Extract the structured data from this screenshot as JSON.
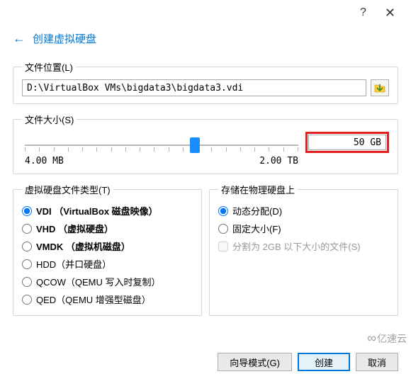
{
  "titlebar": {
    "help_icon": "?",
    "close_icon": "✕"
  },
  "header": {
    "back_arrow": "←",
    "title": "创建虚拟硬盘"
  },
  "file_location": {
    "legend": "文件位置(L)",
    "path": "D:\\VirtualBox VMs\\bigdata3\\bigdata3.vdi"
  },
  "file_size": {
    "legend": "文件大小(S)",
    "value": "50 GB",
    "min_label": "4.00 MB",
    "max_label": "2.00 TB"
  },
  "disk_type": {
    "legend": "虚拟硬盘文件类型(T)",
    "options": [
      {
        "label": "VDI （VirtualBox 磁盘映像）",
        "selected": true,
        "bold": true
      },
      {
        "label": "VHD （虚拟硬盘）",
        "selected": false,
        "bold": true
      },
      {
        "label": "VMDK （虚拟机磁盘）",
        "selected": false,
        "bold": true
      },
      {
        "label": "HDD（并口硬盘）",
        "selected": false,
        "bold": false
      },
      {
        "label": "QCOW（QEMU 写入时复制）",
        "selected": false,
        "bold": false
      },
      {
        "label": "QED（QEMU 增强型磁盘）",
        "selected": false,
        "bold": false
      }
    ]
  },
  "storage": {
    "legend": "存储在物理硬盘上",
    "options": [
      {
        "label": "动态分配(D)",
        "selected": true
      },
      {
        "label": "固定大小(F)",
        "selected": false
      }
    ],
    "split_label": "分割为 2GB 以下大小的文件(S)"
  },
  "footer": {
    "expert": "向导模式(G)",
    "create": "创建",
    "cancel": "取消"
  },
  "watermark": {
    "text": "亿速云"
  }
}
